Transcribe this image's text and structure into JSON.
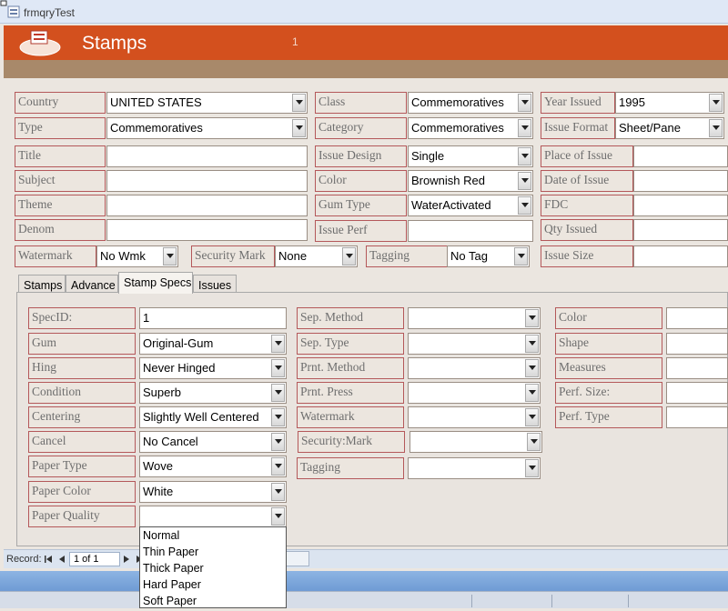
{
  "window": {
    "title": "frmqryTest"
  },
  "header": {
    "title": "Stamps",
    "record_number": "1"
  },
  "top_fields": {
    "country": {
      "label": "Country",
      "value": "UNITED STATES"
    },
    "class": {
      "label": "Class",
      "value": "Commemoratives"
    },
    "year_issued": {
      "label": "Year Issued",
      "value": "1995"
    },
    "type": {
      "label": "Type",
      "value": "Commemoratives"
    },
    "category": {
      "label": "Category",
      "value": "Commemoratives"
    },
    "issue_format": {
      "label": "Issue Format",
      "value": "Sheet/Pane"
    },
    "title": {
      "label": "Title",
      "value": ""
    },
    "issue_design": {
      "label": "Issue Design",
      "value": "Single"
    },
    "place_of_issue": {
      "label": "Place of Issue",
      "value": ""
    },
    "subject": {
      "label": "Subject",
      "value": ""
    },
    "color": {
      "label": "Color",
      "value": "Brownish Red"
    },
    "date_of_issue": {
      "label": "Date of Issue",
      "value": ""
    },
    "theme": {
      "label": "Theme",
      "value": ""
    },
    "gum_type": {
      "label": "Gum Type",
      "value": "WaterActivated"
    },
    "fdc": {
      "label": "FDC",
      "value": ""
    },
    "denom": {
      "label": "Denom",
      "value": ""
    },
    "issue_perf": {
      "label": "Issue Perf",
      "value": ""
    },
    "qty_issued": {
      "label": "Qty Issued",
      "value": ""
    },
    "watermark": {
      "label": "Watermark",
      "value": "No Wmk"
    },
    "security_mark": {
      "label": "Security Mark",
      "value": "None"
    },
    "tagging": {
      "label": "Tagging",
      "value": "No Tag"
    },
    "issue_size": {
      "label": "Issue Size",
      "value": ""
    }
  },
  "tabs": [
    {
      "label": "Stamps"
    },
    {
      "label": "Advance"
    },
    {
      "label": "Stamp Specs"
    },
    {
      "label": "Issues"
    }
  ],
  "specs": {
    "spec_id": {
      "label": "SpecID:",
      "value": "1"
    },
    "gum": {
      "label": "Gum",
      "value": "Original-Gum"
    },
    "hing": {
      "label": "Hing",
      "value": "Never Hinged"
    },
    "condition": {
      "label": "Condition",
      "value": "Superb"
    },
    "centering": {
      "label": "Centering",
      "value": "Slightly Well Centered"
    },
    "cancel": {
      "label": "Cancel",
      "value": "No Cancel"
    },
    "paper_type": {
      "label": "Paper Type",
      "value": "Wove"
    },
    "paper_color": {
      "label": "Paper Color",
      "value": "White"
    },
    "paper_quality": {
      "label": "Paper Quality",
      "value": ""
    },
    "sep_method": {
      "label": "Sep. Method",
      "value": ""
    },
    "sep_type": {
      "label": "Sep. Type",
      "value": ""
    },
    "prnt_method": {
      "label": "Prnt. Method",
      "value": ""
    },
    "prnt_press": {
      "label": "Prnt. Press",
      "value": ""
    },
    "watermark": {
      "label": "Watermark",
      "value": ""
    },
    "security_mark": {
      "label": "Security:Mark",
      "value": ""
    },
    "tagging": {
      "label": "Tagging",
      "value": ""
    },
    "color": {
      "label": "Color",
      "value": ""
    },
    "shape": {
      "label": "Shape",
      "value": ""
    },
    "measures": {
      "label": "Measures",
      "value": ""
    },
    "perf_size": {
      "label": "Perf. Size:",
      "value": ""
    },
    "perf_type": {
      "label": "Perf. Type",
      "value": ""
    }
  },
  "paper_quality_options": [
    "Normal",
    "Thin Paper",
    "Thick Paper",
    "Hard Paper",
    "Soft Paper"
  ],
  "navigation": {
    "label": "Record:",
    "current": "1 of 1"
  }
}
